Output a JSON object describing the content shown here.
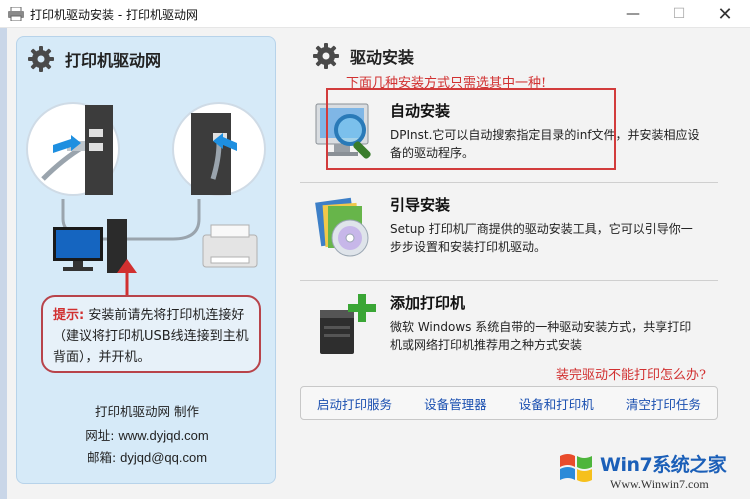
{
  "window": {
    "title": "打印机驱动安装 - 打印机驱动网",
    "minimize_glyph": "—",
    "maximize_glyph": "☐",
    "close_glyph": "✕"
  },
  "left_panel": {
    "title": "打印机驱动网",
    "tip_label": "提示:",
    "tip_text": "安装前请先将打印机连接好（建议将打印机USB线连接到主机背面），并开机。",
    "credit_line": "打印机驱动网  制作",
    "website_label": "网址:",
    "website": "www.dyjqd.com",
    "email_label": "邮箱:",
    "email": "dyjqd@qq.com"
  },
  "right_panel": {
    "title": "驱动安装",
    "subtitle": "下面几种安装方式只需选其中一种!",
    "options": [
      {
        "title": "自动安装",
        "description": "DPInst.它可以自动搜索指定目录的inf文件，并安装相应设备的驱动程序。",
        "icon": "magnifier-monitor-icon"
      },
      {
        "title": "引导安装",
        "description": "Setup 打印机厂商提供的驱动安装工具，它可以引导你一步步设置和安装打印机驱动。",
        "icon": "setup-cd-icon"
      },
      {
        "title": "添加打印机",
        "description": "微软 Windows 系统自带的一种驱动安装方式，共享打印机或网络打印机推荐用之种方式安装",
        "icon": "add-printer-icon"
      }
    ],
    "help_link": "装完驱动不能打印怎么办?",
    "links": [
      "启动打印服务",
      "设备管理器",
      "设备和打印机",
      "清空打印任务"
    ]
  },
  "watermark": {
    "brand": "Win7系统之家",
    "url": "Www.Winwin7.com"
  },
  "colors": {
    "accent_red": "#d13030",
    "link_blue": "#1a4fb0",
    "panel_blue": "#d6eaf8"
  }
}
